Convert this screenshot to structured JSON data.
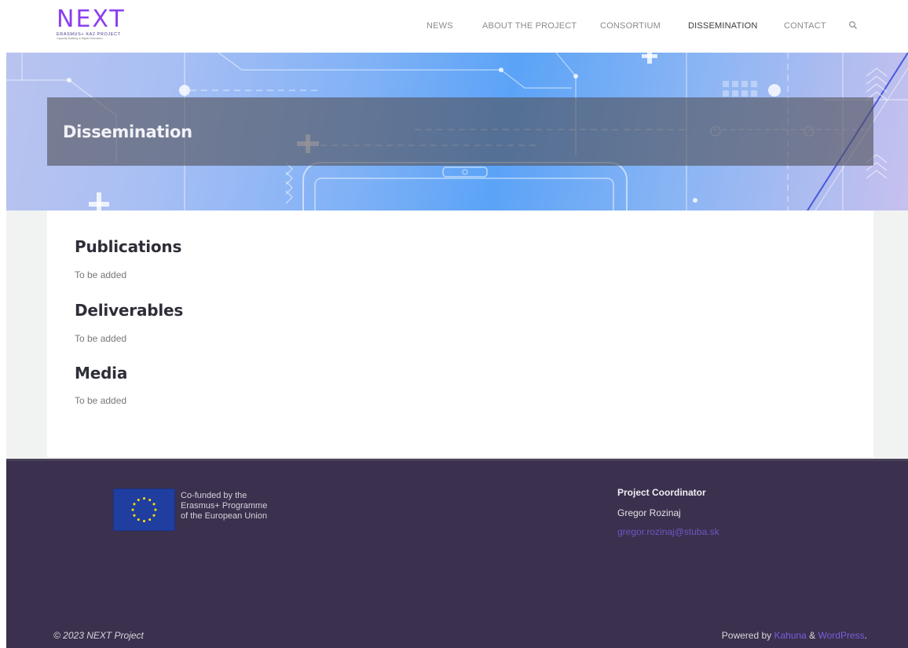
{
  "logo": {
    "word": "NEXT",
    "line1": "ERASMUS+ KA2 PROJECT",
    "line2": "Capacity Building in Higher Education"
  },
  "nav": {
    "items": [
      {
        "label": "NEWS"
      },
      {
        "label": "ABOUT THE PROJECT"
      },
      {
        "label": "CONSORTIUM"
      },
      {
        "label": "DISSEMINATION"
      },
      {
        "label": "CONTACT"
      }
    ],
    "active": "DISSEMINATION",
    "search_icon": "search-icon"
  },
  "hero": {
    "title": "Dissemination"
  },
  "sections": [
    {
      "title": "Publications",
      "text": "To be added"
    },
    {
      "title": "Deliverables",
      "text": "To be added"
    },
    {
      "title": "Media",
      "text": "To be added"
    }
  ],
  "footer": {
    "eu": {
      "line1": "Co-funded by the",
      "line2": "Erasmus+ Programme",
      "line3": "of the European Union"
    },
    "coordinator": {
      "title": "Project Coordinator",
      "name": "Gregor Rozinaj",
      "email": "gregor.rozinaj@stuba.sk"
    },
    "copyright": "© 2023 NEXT Project",
    "powered_prefix": "Powered by ",
    "powered_theme": "Kahuna",
    "powered_sep": " & ",
    "powered_cms": "WordPress",
    "powered_suffix": "."
  },
  "colors": {
    "accent": "#8a3ff0",
    "footer_bg": "#3b304d",
    "link": "#7b5ce0"
  }
}
